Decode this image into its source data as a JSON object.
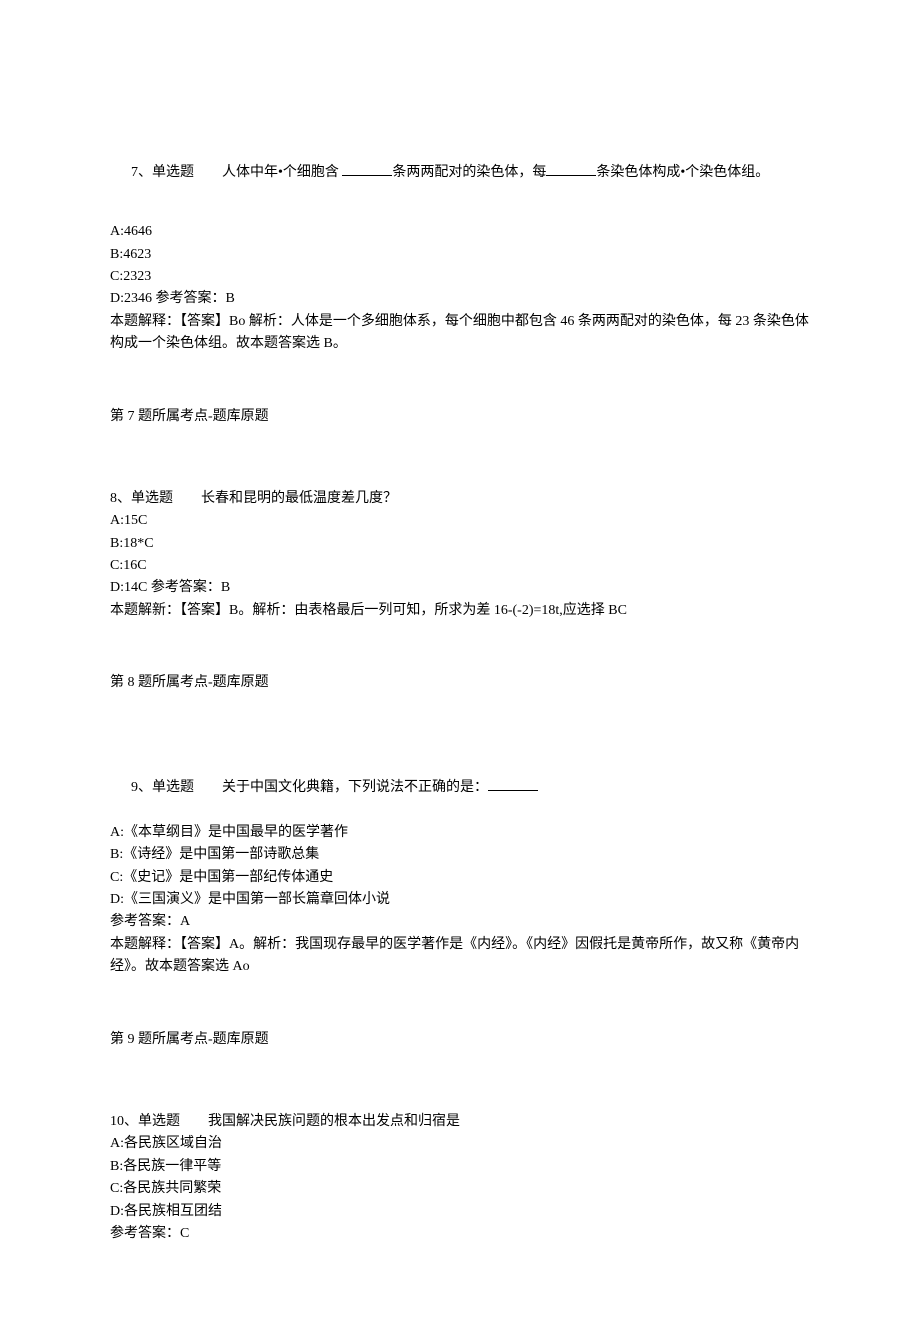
{
  "q7": {
    "header_prefix": "7、单选题　　人体中年•个细胞含 ",
    "header_mid": "条两两配对的染色体，每",
    "header_suffix": "条染色体构成•个染色体组。",
    "optA": "A:4646",
    "optB": "B:4623",
    "optC": "C:2323",
    "optD_ans": "D:2346 参考答案：B",
    "explain": "本题解释：【答案】Bo 解析：人体是一个多细胞体系，每个细胞中都包含 46 条两两配对的染色体，每 23 条染色体构成一个染色体组。故本题答案选 B。",
    "ref": "第 7 题所属考点-题库原题"
  },
  "q8": {
    "header": "8、单选题　　长春和昆明的最低温度差几度？",
    "optA": "A:15C",
    "optB": "B:18*C",
    "optC": "C:16C",
    "optD_ans": "D:14C 参考答案：B",
    "explain": "本题解新：【答案】B。解析：由表格最后一列可知，所求为差 16-(-2)=18t,应选择 BC",
    "ref": "第 8 题所属考点-题库原题"
  },
  "q9": {
    "header_prefix": "9、单选题　　关于中国文化典籍，下列说法不正确的是：",
    "optA": "A:《本草纲目》是中国最早的医学著作",
    "optB": "B:《诗经》是中国第一部诗歌总集",
    "optC": "C:《史记》是中国第一部纪传体通史",
    "optD": "D:《三国演义》是中国第一部长篇章回体小说",
    "ans": "参考答案：A",
    "explain": "本题解释：【答案】A。解析：我国现存最早的医学著作是《内经》。《内经》因假托是黄帝所作，故又称《黄帝内经》。故本题答案选 Ao",
    "ref": "第 9 题所属考点-题库原题"
  },
  "q10": {
    "header": "10、单选题　　我国解决民族问题的根本出发点和归宿是",
    "optA": "A:各民族区域自治",
    "optB": "B:各民族一律平等",
    "optC": "C:各民族共同繁荣",
    "optD": "D:各民族相互团结",
    "ans": "参考答案：C"
  }
}
